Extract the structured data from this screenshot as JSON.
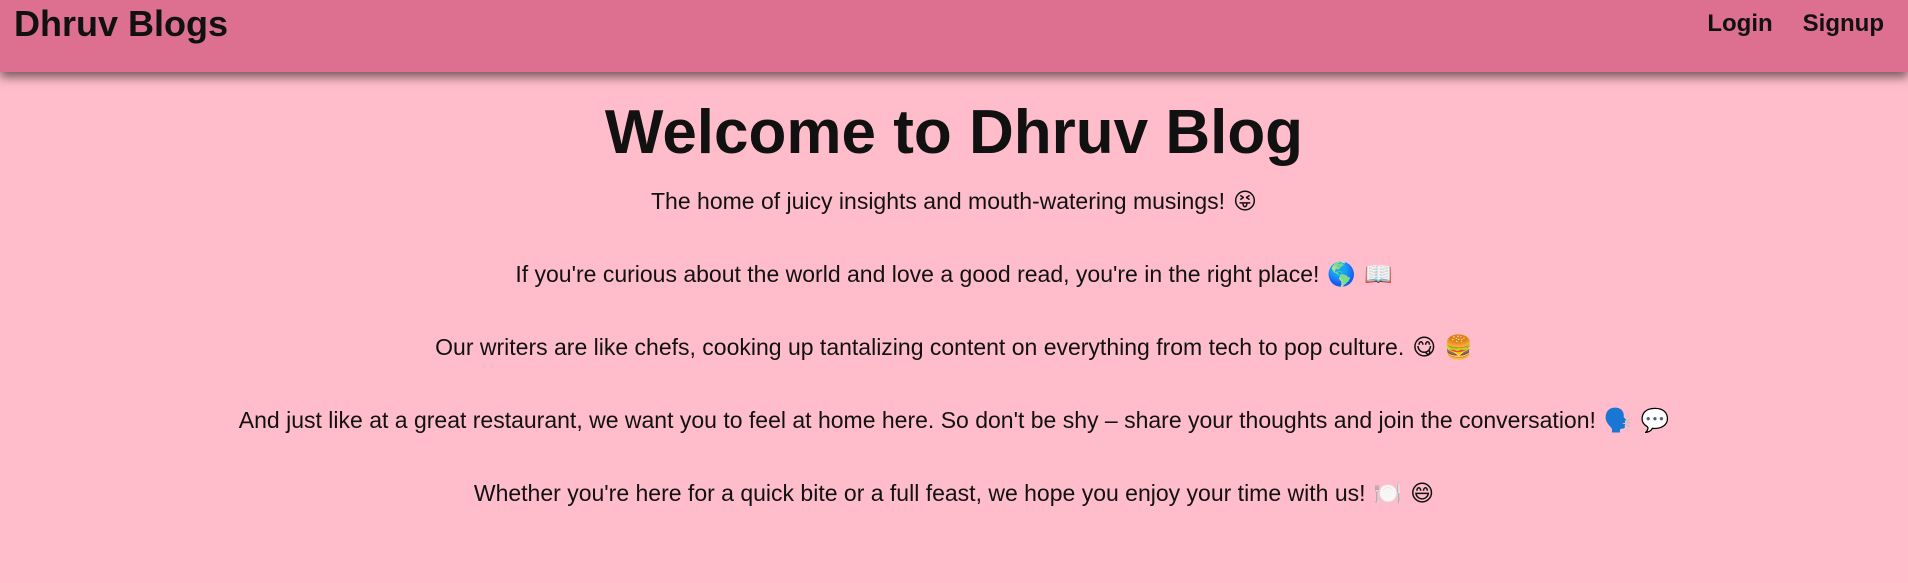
{
  "nav": {
    "brand": "Dhruv Blogs",
    "links": [
      "Login",
      "Signup"
    ]
  },
  "main": {
    "title": "Welcome to Dhruv Blog",
    "paragraphs": [
      {
        "text": "The home of juicy insights and mouth-watering musings!",
        "emojis": [
          "😝"
        ]
      },
      {
        "text": "If you're curious about the world and love a good read, you're in the right place!",
        "emojis": [
          "🌎",
          "📖"
        ]
      },
      {
        "text": "Our writers are like chefs, cooking up tantalizing content on everything from tech to pop culture.",
        "emojis": [
          "😋",
          "🍔"
        ]
      },
      {
        "text": "And just like at a great restaurant, we want you to feel at home here. So don't be shy – share your thoughts and join the conversation!",
        "emojis": [
          "🗣️",
          "💬"
        ]
      },
      {
        "text": "Whether you're here for a quick bite or a full feast, we hope you enjoy your time with us!",
        "emojis": [
          "🍽️",
          "😄"
        ]
      }
    ]
  },
  "colors": {
    "background": "#FFBDCB",
    "navbar": "#DD6F91",
    "text": "#111111"
  }
}
